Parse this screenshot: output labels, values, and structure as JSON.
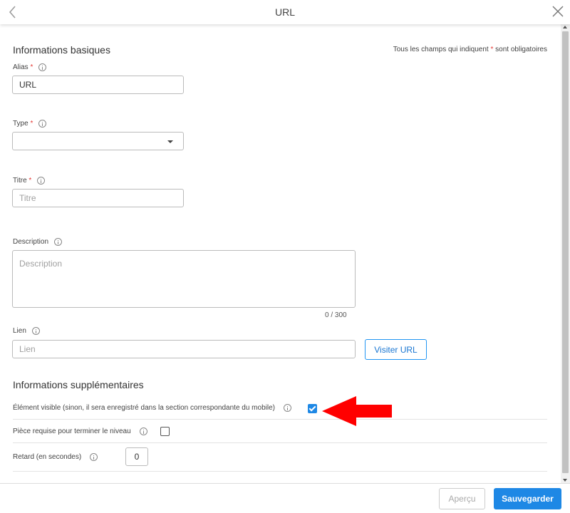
{
  "header": {
    "title": "URL",
    "back_icon": "chevron-left-icon",
    "close_icon": "close-icon"
  },
  "basic": {
    "section_title": "Informations basiques",
    "required_note_prefix": "Tous les champs qui indiquent",
    "required_star": "*",
    "required_note_suffix": "sont obligatoires",
    "alias": {
      "label": "Alias",
      "value": "URL"
    },
    "type": {
      "label": "Type",
      "value": ""
    },
    "title": {
      "label": "Titre",
      "placeholder": "Titre"
    },
    "description": {
      "label": "Description",
      "placeholder": "Description",
      "counter": "0 / 300"
    },
    "link": {
      "label": "Lien",
      "placeholder": "Lien",
      "visit_button": "Visiter URL"
    }
  },
  "extra": {
    "section_title": "Informations supplémentaires",
    "visible": {
      "label": "Élément visible (sinon, il sera enregistré dans la section correspondante du mobile)",
      "checked": true
    },
    "required_piece": {
      "label": "Pièce requise pour terminer le niveau",
      "checked": false
    },
    "delay": {
      "label": "Retard (en secondes)",
      "value": "0"
    }
  },
  "footer": {
    "preview_label": "Aperçu",
    "save_label": "Sauvegarder"
  },
  "colors": {
    "accent": "#1e88e5",
    "required": "#e53935",
    "annotation_arrow": "#ff0000"
  }
}
